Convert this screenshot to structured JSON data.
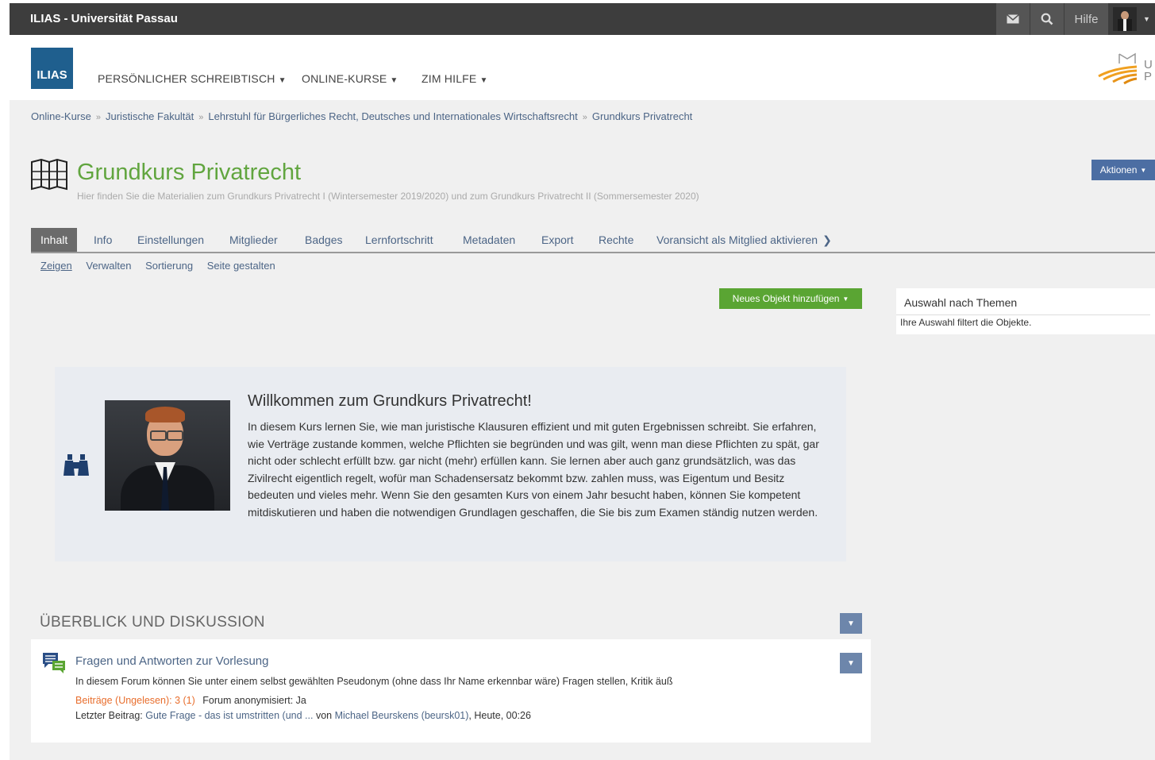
{
  "topbar": {
    "title": "ILIAS - Universität Passau",
    "help_label": "Hilfe"
  },
  "header": {
    "logo_text": "ILIAS",
    "nav": [
      {
        "label": "PERSÖNLICHER SCHREIBTISCH"
      },
      {
        "label": "ONLINE-KURSE"
      },
      {
        "label": "ZIM HILFE"
      }
    ],
    "uni_logo_text": "U P"
  },
  "breadcrumb": [
    "Online-Kurse",
    "Juristische Fakultät",
    "Lehrstuhl für Bürgerliches Recht, Deutsches und Internationales Wirtschaftsrecht",
    "Grundkurs Privatrecht"
  ],
  "course": {
    "title": "Grundkurs Privatrecht",
    "description": "Hier finden Sie die Materialien zum Grundkurs Privatrecht I (Wintersemester 2019/2020) und zum Grundkurs Privatrecht II (Sommersemester 2020)",
    "actions_label": "Aktionen"
  },
  "tabs": [
    {
      "label": "Inhalt",
      "active": true
    },
    {
      "label": "Info"
    },
    {
      "label": "Einstellungen"
    },
    {
      "label": "Mitglieder"
    },
    {
      "label": "Badges"
    },
    {
      "label": "Lernfortschritt"
    },
    {
      "label": "Metadaten"
    },
    {
      "label": "Export"
    },
    {
      "label": "Rechte"
    },
    {
      "label": "Voransicht als Mitglied aktivieren"
    }
  ],
  "subtabs": [
    {
      "label": "Zeigen",
      "active": true
    },
    {
      "label": "Verwalten"
    },
    {
      "label": "Sortierung"
    },
    {
      "label": "Seite gestalten"
    }
  ],
  "add_object_label": "Neues Objekt hinzufügen",
  "sidebar": {
    "title": "Auswahl nach Themen",
    "text": "Ihre Auswahl filtert die Objekte."
  },
  "welcome": {
    "title": "Willkommen zum Grundkurs Privatrecht!",
    "text": "In diesem Kurs lernen Sie, wie man juristische Klausuren effizient und mit guten Ergebnissen schreibt. Sie erfahren, wie Verträge zustande kommen, welche Pflichten sie begründen und was gilt, wenn man diese Pflichten zu spät, gar nicht oder schlecht erfüllt bzw. gar nicht (mehr) erfüllen kann. Sie lernen aber auch ganz grundsätzlich, was das Zivilrecht eigentlich regelt, wofür man Schadensersatz bekommt bzw. zahlen muss, was Eigentum und Besitz bedeuten und vieles mehr. Wenn Sie den gesamten Kurs von einem Jahr besucht haben, können Sie kompetent mitdiskutieren und haben die notwendigen Grundlagen geschaffen, die Sie bis zum Examen ständig nutzen werden."
  },
  "section": {
    "title": "ÜBERBLICK UND DISKUSSION"
  },
  "forum": {
    "title": "Fragen und Antworten zur Vorlesung",
    "description": "In diesem Forum können Sie unter einem selbst gewählten Pseudonym (ohne dass Ihr Name erkennbar wäre) Fragen stellen, Kritik äuß",
    "posts_label": "Beiträge (Ungelesen): 3 (1)",
    "anon_label": "Forum anonymisiert: Ja",
    "last_prefix": "Letzter Beitrag:",
    "last_title": "Gute Frage - das ist umstritten (und ...",
    "last_by": "von",
    "last_author": "Michael Beurskens (beursk01)",
    "last_time": ", Heute, 00:26"
  },
  "colors": {
    "topbar": "#3d3d3d",
    "logo": "#1f5f8e",
    "title_green": "#61a53f",
    "button_green": "#5aa533",
    "button_blue": "#4c6ea3",
    "link": "#4c6586",
    "orange": "#e86e2d"
  }
}
